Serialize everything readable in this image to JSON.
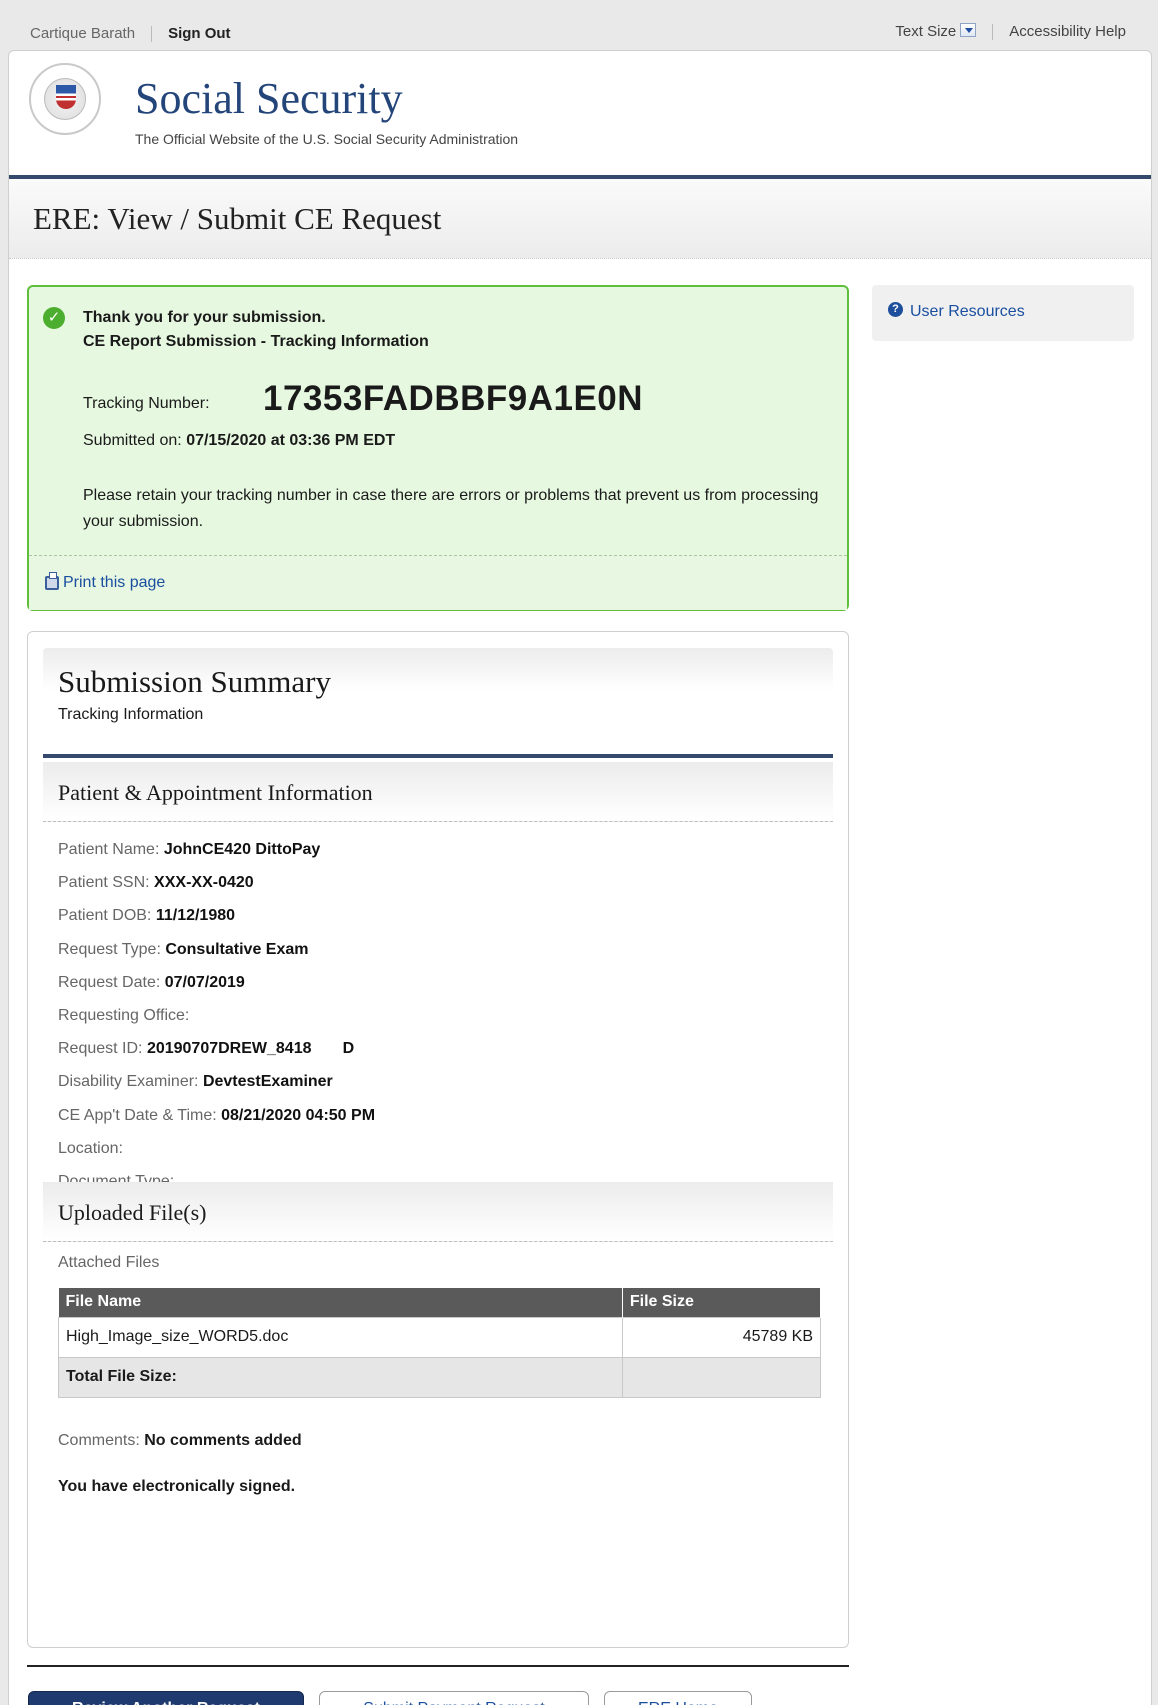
{
  "util": {
    "user_name": "Cartique Barath",
    "sign_out": "Sign Out",
    "text_size": "Text Size",
    "accessibility": "Accessibility Help"
  },
  "header": {
    "site_title": "Social Security",
    "tagline": "The Official Website of the U.S. Social Security Administration"
  },
  "page": {
    "title": "ERE: View / Submit CE Request"
  },
  "success": {
    "thanks": "Thank you for your submission.",
    "subtitle": "CE Report Submission - Tracking Information",
    "tracking_label": "Tracking Number:",
    "tracking_number": "17353FADBBF9A1E0N",
    "submitted_label": "Submitted on:",
    "submitted_value": "07/15/2020 at 03:36 PM EDT",
    "retain_text": "Please retain your tracking number in case there are errors or problems that prevent us from processing your submission.",
    "print_link": "Print this page"
  },
  "sidebar": {
    "user_resources": "User Resources"
  },
  "summary": {
    "title": "Submission Summary",
    "subtitle": "Tracking Information",
    "patient_section": "Patient & Appointment Information",
    "fields": [
      {
        "label": "Patient Name: ",
        "value": "JohnCE420 DittoPay"
      },
      {
        "label": "Patient SSN: ",
        "value": "XXX-XX-0420"
      },
      {
        "label": "Patient DOB: ",
        "value": "11/12/1980"
      },
      {
        "label": "Request Type: ",
        "value": "Consultative Exam"
      },
      {
        "label": "Request Date: ",
        "value": "07/07/2019"
      },
      {
        "label": "Requesting Office: ",
        "value": ""
      },
      {
        "label": "Request ID: ",
        "value": "20190707DREW_8418       D"
      },
      {
        "label": "Disability Examiner: ",
        "value": "DevtestExaminer"
      },
      {
        "label": "CE App't Date & Time: ",
        "value": "08/21/2020 04:50 PM"
      },
      {
        "label": "Location: ",
        "value": ""
      },
      {
        "label": "Document Type: ",
        "value": ""
      }
    ],
    "uploaded_section": "Uploaded File(s)",
    "attached_label": "Attached Files",
    "table": {
      "headers": [
        "File Name",
        "File Size"
      ],
      "rows": [
        {
          "name": "High_Image_size_WORD5.doc",
          "size": "45789 KB"
        }
      ],
      "total_label": "Total File Size:",
      "total_value": ""
    },
    "comments_label": "Comments: ",
    "comments_value": "No comments added",
    "signed_text": "You have electronically signed."
  },
  "buttons": {
    "review": "Review Another Request",
    "payment": "Submit Payment Request",
    "home": "ERE Home"
  }
}
